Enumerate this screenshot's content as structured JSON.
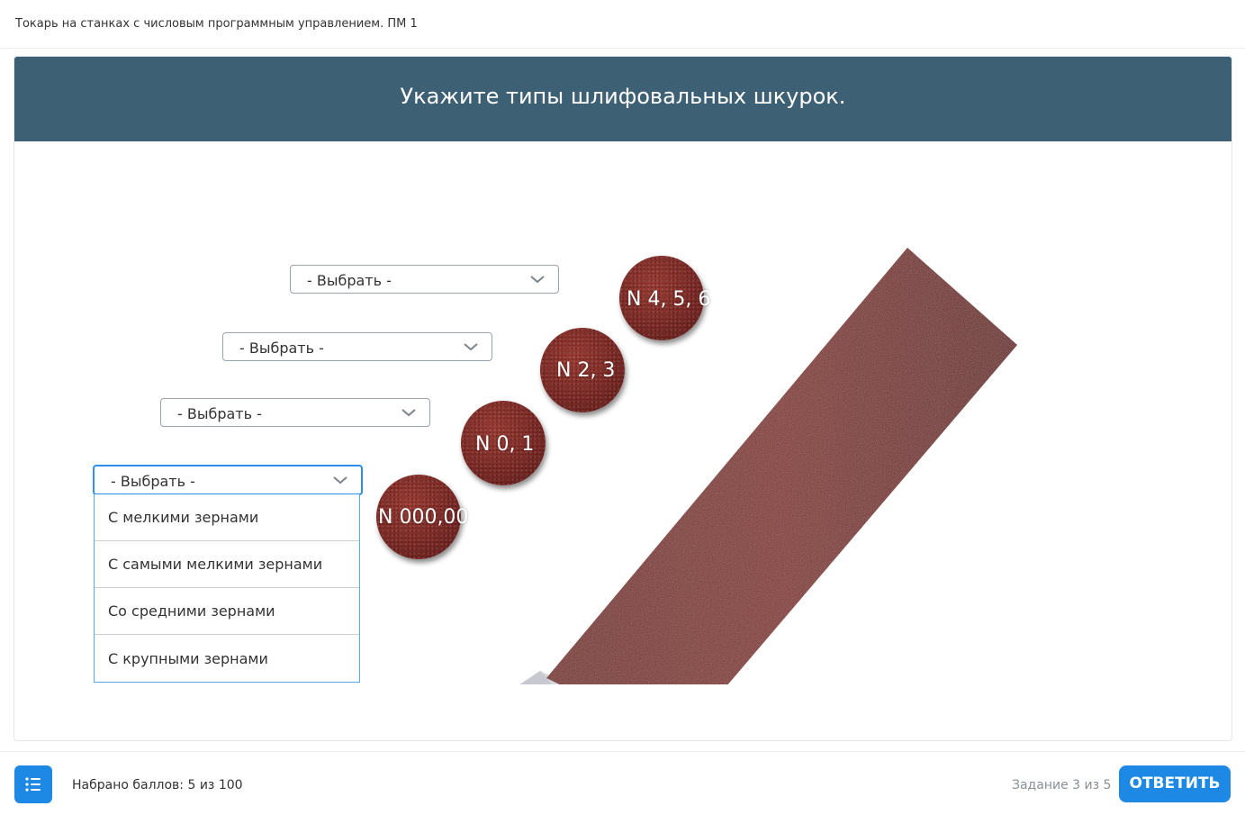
{
  "course": {
    "title": "Токарь на станках с числовым программным управлением. ПМ 1"
  },
  "question": {
    "title": "Укажите типы шлифовальных шкурок."
  },
  "image": {
    "discs": [
      {
        "label": "N 4, 5, 6"
      },
      {
        "label": "N 2, 3"
      },
      {
        "label": "N 0, 1"
      },
      {
        "label": "N 000,00"
      }
    ]
  },
  "selects": [
    {
      "value": "- Выбрать -"
    },
    {
      "value": "- Выбрать -"
    },
    {
      "value": "- Выбрать -"
    },
    {
      "value": "- Выбрать -"
    }
  ],
  "dropdown": {
    "options": [
      "С мелкими зернами",
      "С самыми мелкими зернами",
      "Со средними зернами",
      "С крупными зернами"
    ]
  },
  "footer": {
    "score": "Набрано баллов: 5 из 100",
    "progress": "Задание 3 из 5",
    "answer_label": "ОТВЕТИТЬ"
  },
  "colors": {
    "header": "#3d6075",
    "accent": "#1e88e5",
    "sandpaper": "#7c2a26"
  },
  "icons": {
    "list_button": "list-icon",
    "select_chevron": "chevron-down-icon"
  }
}
